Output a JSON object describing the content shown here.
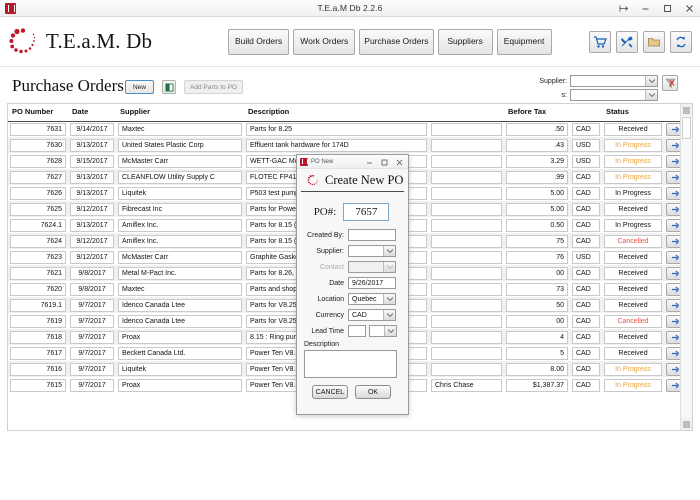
{
  "window": {
    "title": "T.E.a.M Db 2.2.6",
    "icon": "app-icon",
    "controls": {
      "pin": "⇥",
      "minimize": "–",
      "maximize": "□",
      "close": "✕"
    }
  },
  "header": {
    "brand": "T.E.a.M. Db",
    "nav": [
      {
        "label": "Build Orders",
        "name": "nav-build-orders"
      },
      {
        "label": "Work Orders",
        "name": "nav-work-orders"
      },
      {
        "label": "Purchase Orders",
        "name": "nav-purchase-orders"
      },
      {
        "label": "Suppliers",
        "name": "nav-suppliers"
      },
      {
        "label": "Equipment",
        "name": "nav-equipment"
      }
    ],
    "tools": [
      {
        "name": "shopping-cart-icon"
      },
      {
        "name": "tools-icon"
      },
      {
        "name": "folder-icon"
      },
      {
        "name": "sync-icon"
      }
    ]
  },
  "page": {
    "title": "Purchase Orders",
    "new_label": "New",
    "excel_icon": "excel-icon",
    "add_parts_label": "Add Parts to PO"
  },
  "filter": {
    "supplier_label": "Supplier:",
    "second_label": "s:",
    "supplier_value": "",
    "second_value": "",
    "clear_icon": "clear-filter-icon"
  },
  "table": {
    "columns": [
      "PO Number",
      "Date",
      "Supplier",
      "Description",
      "",
      "Before Tax",
      "",
      "Status",
      ""
    ],
    "rows": [
      {
        "po": "7631",
        "date": "9/14/2017",
        "supplier": "Maxtec",
        "description": "Parts for 8.25",
        "createdby": "",
        "beforetax": ".50",
        "currency": "CAD",
        "status": "Received",
        "status_class": "st-received"
      },
      {
        "po": "7630",
        "date": "9/13/2017",
        "supplier": "United States Plastic Corp",
        "description": "Effluent tank hardware for 174D",
        "createdby": "",
        "beforetax": ".43",
        "currency": "USD",
        "status": "In Progress",
        "status_class": "st-inprogress"
      },
      {
        "po": "7628",
        "date": "9/15/2017",
        "supplier": "McMaster Carr",
        "description": "WETT-GAC Module Parts",
        "createdby": "",
        "beforetax": "3.29",
        "currency": "USD",
        "status": "In Progress",
        "status_class": "st-inprogress"
      },
      {
        "po": "7627",
        "date": "9/13/2017",
        "supplier": "CLEANFLOW Utility Supply C",
        "description": "FLOTEC FP410515H Cast iron jet pum",
        "createdby": "",
        "beforetax": ".99",
        "currency": "CAD",
        "status": "In Progress",
        "status_class": "st-inprogress"
      },
      {
        "po": "7626",
        "date": "9/13/2017",
        "supplier": "Liquitek",
        "description": "P503 test pump for 8.14",
        "createdby": "",
        "beforetax": "5.00",
        "currency": "CAD",
        "status": "In Progress",
        "status_class": "st-received"
      },
      {
        "po": "7625",
        "date": "9/12/2017",
        "supplier": "Fibrecast Inc",
        "description": "Parts for Power 10 (corrected qty)",
        "createdby": "",
        "beforetax": "5.00",
        "currency": "CAD",
        "status": "Received",
        "status_class": "st-received"
      },
      {
        "po": "7624.1",
        "date": "9/13/2017",
        "supplier": "Amiflex Inc.",
        "description": "Parts for 8.15 (2) and spares (4)",
        "createdby": "",
        "beforetax": "0.50",
        "currency": "CAD",
        "status": "In Progress",
        "status_class": "st-received"
      },
      {
        "po": "7624",
        "date": "9/12/2017",
        "supplier": "Amiflex Inc.",
        "description": "Parts for 8.15 (2) and spares (4)",
        "createdby": "",
        "beforetax": "75",
        "currency": "CAD",
        "status": "Cancelled",
        "status_class": "st-cancelled"
      },
      {
        "po": "7623",
        "date": "9/12/2017",
        "supplier": "McMaster Carr",
        "description": "Graphite Gaskets for 8.25 (6), 8.26 (",
        "createdby": "",
        "beforetax": "76",
        "currency": "USD",
        "status": "Received",
        "status_class": "st-received"
      },
      {
        "po": "7621",
        "date": "9/8/2017",
        "supplier": "Metal M-Pact Inc.",
        "description": "Parts for 8.26, 27 , 28 , 29 30 and 10 ",
        "createdby": "",
        "beforetax": "00",
        "currency": "CAD",
        "status": "Received",
        "status_class": "st-received"
      },
      {
        "po": "7620",
        "date": "9/8/2017",
        "supplier": "Maxtec",
        "description": "Parts and shop supplies for field se",
        "createdby": "",
        "beforetax": "73",
        "currency": "CAD",
        "status": "Received",
        "status_class": "st-received"
      },
      {
        "po": "7619.1",
        "date": "9/7/2017",
        "supplier": "Idenco Canada Ltee",
        "description": "Parts for V8.25",
        "createdby": "",
        "beforetax": "50",
        "currency": "CAD",
        "status": "Received",
        "status_class": "st-received"
      },
      {
        "po": "7619",
        "date": "9/7/2017",
        "supplier": "Idenco Canada Ltee",
        "description": "Parts for V8.25",
        "createdby": "",
        "beforetax": "00",
        "currency": "CAD",
        "status": "Cancelled",
        "status_class": "st-cancelled"
      },
      {
        "po": "7618",
        "date": "9/7/2017",
        "supplier": "Proax",
        "description": "8.15 : Ring pump overload",
        "createdby": "",
        "beforetax": "4",
        "currency": "CAD",
        "status": "Received",
        "status_class": "st-received"
      },
      {
        "po": "7617",
        "date": "9/7/2017",
        "supplier": "Beckett Canada Ltd.",
        "description": "Power Ten V8.30 Batch Order #1",
        "createdby": "",
        "beforetax": "5",
        "currency": "CAD",
        "status": "Received",
        "status_class": "st-received"
      },
      {
        "po": "7616",
        "date": "9/7/2017",
        "supplier": "Liquitek",
        "description": "Power Ten V8.30 Batch Order #1",
        "createdby": "",
        "beforetax": "8.00",
        "currency": "CAD",
        "status": "In Progress",
        "status_class": "st-inprogress"
      },
      {
        "po": "7615",
        "date": "9/7/2017",
        "supplier": "Proax",
        "description": "Power Ten V8.30 Batch Order #1",
        "createdby": "Chris Chase",
        "beforetax": "$1,387.37",
        "currency": "CAD",
        "status": "In Progress",
        "status_class": "st-inprogress"
      }
    ],
    "row_action_icon": "row-detail-arrow-icon"
  },
  "dialog": {
    "titlebar_text": "PO New",
    "titlebar_icon": "app-icon",
    "controls": {
      "minimize": "–",
      "maximize": "□",
      "close": "✕"
    },
    "heading": "Create New PO",
    "po_label": "PO#:",
    "po_value": "7657",
    "fields": [
      {
        "label": "Created By:",
        "value": "",
        "type": "text",
        "name": "created-by-field",
        "disabled": false
      },
      {
        "label": "Supplier:",
        "value": "",
        "type": "combo",
        "name": "supplier-select",
        "disabled": false
      },
      {
        "label": "Contact",
        "value": "",
        "type": "combo",
        "name": "contact-select",
        "disabled": true
      },
      {
        "label": "Date",
        "value": "9/26/2017",
        "type": "text",
        "name": "date-field",
        "disabled": false
      },
      {
        "label": "Location",
        "value": "Quebec",
        "type": "combo",
        "name": "location-select",
        "disabled": false
      },
      {
        "label": "Currency",
        "value": "CAD",
        "type": "combo",
        "name": "currency-select",
        "disabled": false
      }
    ],
    "lead_time_label": "Lead Time",
    "lead_time_value": "",
    "lead_time_unit": "",
    "description_label": "Description",
    "description_value": "",
    "cancel_label": "CANCEL",
    "ok_label": "OK"
  },
  "colors": {
    "brand_red": "#c0162a",
    "accent_blue": "#4a90c4",
    "status_inprogress": "#e8a33d",
    "status_cancelled": "#f0504a",
    "nav_button": "#e4e4e4"
  }
}
